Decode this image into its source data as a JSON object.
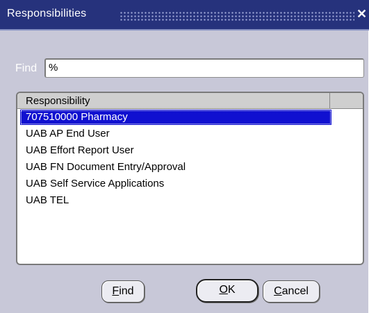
{
  "window": {
    "title": "Responsibilities",
    "close_glyph": "✕"
  },
  "find": {
    "label": "Find",
    "value": "%"
  },
  "list": {
    "column_header": "Responsibility",
    "selected_index": 0,
    "rows": [
      "707510000 Pharmacy",
      "UAB AP End User",
      "UAB Effort Report User",
      "UAB FN Document Entry/Approval",
      "UAB Self Service Applications",
      "UAB TEL"
    ]
  },
  "buttons": {
    "find": {
      "mnemonic": "F",
      "rest": "ind"
    },
    "ok": {
      "mnemonic": "O",
      "rest": "K"
    },
    "cancel": {
      "mnemonic": "C",
      "rest": "ancel"
    }
  },
  "colors": {
    "titlebar": "#26327c",
    "selection": "#1010d0",
    "dialog_bg": "#c8c8d8"
  }
}
